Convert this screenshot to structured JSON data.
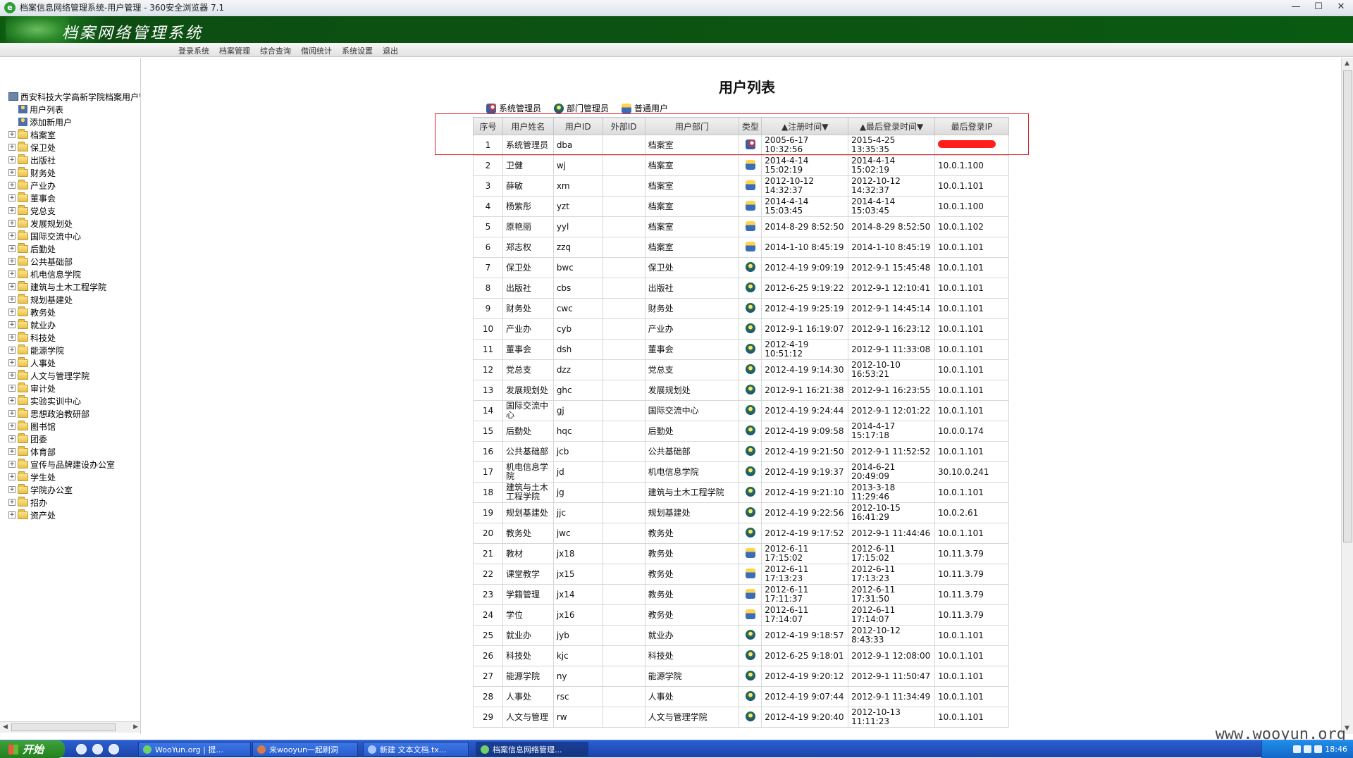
{
  "window": {
    "title": "档案信息网络管理系统-用户管理 - 360安全浏览器 7.1",
    "app_icon": "e"
  },
  "banner": {
    "system_name": "档案网络管理系统"
  },
  "menu": [
    "登录系统",
    "档案管理",
    "综合查询",
    "借阅统计",
    "系统设置",
    "退出"
  ],
  "sidebar": {
    "root": "西安科技大学高新学院档案用户管",
    "user_items": [
      "用户列表",
      "添加新用户"
    ],
    "folders": [
      "档案室",
      "保卫处",
      "出版社",
      "财务处",
      "产业办",
      "董事会",
      "党总支",
      "发展规划处",
      "国际交流中心",
      "后勤处",
      "公共基础部",
      "机电信息学院",
      "建筑与土木工程学院",
      "规划基建处",
      "教务处",
      "就业办",
      "科技处",
      "能源学院",
      "人事处",
      "人文与管理学院",
      "审计处",
      "实验实训中心",
      "思想政治教研部",
      "图书馆",
      "团委",
      "体育部",
      "宣传与品牌建设办公室",
      "学生处",
      "学院办公室",
      "招办",
      "资产处"
    ]
  },
  "page": {
    "title": "用户列表",
    "legend": [
      {
        "icon": "admin-user-icon",
        "label": "系统管理员"
      },
      {
        "icon": "dept-admin-icon",
        "label": "部门管理员"
      },
      {
        "icon": "normal-user-icon",
        "label": "普通用户"
      }
    ],
    "columns": [
      "序号",
      "用户姓名",
      "用户ID",
      "外部ID",
      "用户部门",
      "类型",
      "▲注册时间▼",
      "▲最后登录时间▼",
      "最后登录IP"
    ],
    "rows": [
      {
        "idx": "1",
        "name": "系统管理员",
        "uid": "dba",
        "ext": "",
        "dept": "档案室",
        "type": "admin",
        "reg": "2005-6-17 10:32:56",
        "last": "2015-4-25 13:35:35",
        "ip": "",
        "redacted": true
      },
      {
        "idx": "2",
        "name": "卫健",
        "uid": "wj",
        "ext": "",
        "dept": "档案室",
        "type": "normal",
        "reg": "2014-4-14 15:02:19",
        "last": "2014-4-14 15:02:19",
        "ip": "10.0.1.100"
      },
      {
        "idx": "3",
        "name": "薛敏",
        "uid": "xm",
        "ext": "",
        "dept": "档案室",
        "type": "normal",
        "reg": "2012-10-12 14:32:37",
        "last": "2012-10-12 14:32:37",
        "ip": "10.0.1.101"
      },
      {
        "idx": "4",
        "name": "杨紫彤",
        "uid": "yzt",
        "ext": "",
        "dept": "档案室",
        "type": "normal",
        "reg": "2014-4-14 15:03:45",
        "last": "2014-4-14 15:03:45",
        "ip": "10.0.1.100"
      },
      {
        "idx": "5",
        "name": "原艳丽",
        "uid": "yyl",
        "ext": "",
        "dept": "档案室",
        "type": "normal",
        "reg": "2014-8-29 8:52:50",
        "last": "2014-8-29 8:52:50",
        "ip": "10.0.1.102"
      },
      {
        "idx": "6",
        "name": "郑志权",
        "uid": "zzq",
        "ext": "",
        "dept": "档案室",
        "type": "normal",
        "reg": "2014-1-10 8:45:19",
        "last": "2014-1-10 8:45:19",
        "ip": "10.0.1.101"
      },
      {
        "idx": "7",
        "name": "保卫处",
        "uid": "bwc",
        "ext": "",
        "dept": "保卫处",
        "type": "dept",
        "reg": "2012-4-19 9:09:19",
        "last": "2012-9-1 15:45:48",
        "ip": "10.0.1.101"
      },
      {
        "idx": "8",
        "name": "出版社",
        "uid": "cbs",
        "ext": "",
        "dept": "出版社",
        "type": "dept",
        "reg": "2012-6-25 9:19:22",
        "last": "2012-9-1 12:10:41",
        "ip": "10.0.1.101"
      },
      {
        "idx": "9",
        "name": "财务处",
        "uid": "cwc",
        "ext": "",
        "dept": "财务处",
        "type": "dept",
        "reg": "2012-4-19 9:25:19",
        "last": "2012-9-1 14:45:14",
        "ip": "10.0.1.101"
      },
      {
        "idx": "10",
        "name": "产业办",
        "uid": "cyb",
        "ext": "",
        "dept": "产业办",
        "type": "dept",
        "reg": "2012-9-1 16:19:07",
        "last": "2012-9-1 16:23:12",
        "ip": "10.0.1.101"
      },
      {
        "idx": "11",
        "name": "董事会",
        "uid": "dsh",
        "ext": "",
        "dept": "董事会",
        "type": "dept",
        "reg": "2012-4-19 10:51:12",
        "last": "2012-9-1 11:33:08",
        "ip": "10.0.1.101"
      },
      {
        "idx": "12",
        "name": "党总支",
        "uid": "dzz",
        "ext": "",
        "dept": "党总支",
        "type": "dept",
        "reg": "2012-4-19 9:14:30",
        "last": "2012-10-10 16:53:21",
        "ip": "10.0.1.101"
      },
      {
        "idx": "13",
        "name": "发展规划处",
        "uid": "ghc",
        "ext": "",
        "dept": "发展规划处",
        "type": "dept",
        "reg": "2012-9-1 16:21:38",
        "last": "2012-9-1 16:23:55",
        "ip": "10.0.1.101"
      },
      {
        "idx": "14",
        "name": "国际交流中心",
        "uid": "gj",
        "ext": "",
        "dept": "国际交流中心",
        "type": "dept",
        "reg": "2012-4-19 9:24:44",
        "last": "2012-9-1 12:01:22",
        "ip": "10.0.1.101"
      },
      {
        "idx": "15",
        "name": "后勤处",
        "uid": "hqc",
        "ext": "",
        "dept": "后勤处",
        "type": "dept",
        "reg": "2012-4-19 9:09:58",
        "last": "2014-4-17 15:17:18",
        "ip": "10.0.0.174"
      },
      {
        "idx": "16",
        "name": "公共基础部",
        "uid": "jcb",
        "ext": "",
        "dept": "公共基础部",
        "type": "dept",
        "reg": "2012-4-19 9:21:50",
        "last": "2012-9-1 11:52:52",
        "ip": "10.0.1.101"
      },
      {
        "idx": "17",
        "name": "机电信息学院",
        "uid": "jd",
        "ext": "",
        "dept": "机电信息学院",
        "type": "dept",
        "reg": "2012-4-19 9:19:37",
        "last": "2014-6-21 20:49:09",
        "ip": "30.10.0.241"
      },
      {
        "idx": "18",
        "name": "建筑与土木工程学院",
        "uid": "jg",
        "ext": "",
        "dept": "建筑与土木工程学院",
        "type": "dept",
        "reg": "2012-4-19 9:21:10",
        "last": "2013-3-18 11:29:46",
        "ip": "10.0.1.101"
      },
      {
        "idx": "19",
        "name": "规划基建处",
        "uid": "jjc",
        "ext": "",
        "dept": "规划基建处",
        "type": "dept",
        "reg": "2012-4-19 9:22:56",
        "last": "2012-10-15 16:41:29",
        "ip": "10.0.2.61"
      },
      {
        "idx": "20",
        "name": "教务处",
        "uid": "jwc",
        "ext": "",
        "dept": "教务处",
        "type": "dept",
        "reg": "2012-4-19 9:17:52",
        "last": "2012-9-1 11:44:46",
        "ip": "10.0.1.101"
      },
      {
        "idx": "21",
        "name": "教材",
        "uid": "jx18",
        "ext": "",
        "dept": "教务处",
        "type": "normal",
        "reg": "2012-6-11 17:15:02",
        "last": "2012-6-11 17:15:02",
        "ip": "10.11.3.79"
      },
      {
        "idx": "22",
        "name": "课堂教学",
        "uid": "jx15",
        "ext": "",
        "dept": "教务处",
        "type": "normal",
        "reg": "2012-6-11 17:13:23",
        "last": "2012-6-11 17:13:23",
        "ip": "10.11.3.79"
      },
      {
        "idx": "23",
        "name": "学籍管理",
        "uid": "jx14",
        "ext": "",
        "dept": "教务处",
        "type": "normal",
        "reg": "2012-6-11 17:11:37",
        "last": "2012-6-11 17:31:50",
        "ip": "10.11.3.79"
      },
      {
        "idx": "24",
        "name": "学位",
        "uid": "jx16",
        "ext": "",
        "dept": "教务处",
        "type": "normal",
        "reg": "2012-6-11 17:14:07",
        "last": "2012-6-11 17:14:07",
        "ip": "10.11.3.79"
      },
      {
        "idx": "25",
        "name": "就业办",
        "uid": "jyb",
        "ext": "",
        "dept": "就业办",
        "type": "dept",
        "reg": "2012-4-19 9:18:57",
        "last": "2012-10-12 8:43:33",
        "ip": "10.0.1.101"
      },
      {
        "idx": "26",
        "name": "科技处",
        "uid": "kjc",
        "ext": "",
        "dept": "科技处",
        "type": "dept",
        "reg": "2012-6-25 9:18:01",
        "last": "2012-9-1 12:08:00",
        "ip": "10.0.1.101"
      },
      {
        "idx": "27",
        "name": "能源学院",
        "uid": "ny",
        "ext": "",
        "dept": "能源学院",
        "type": "dept",
        "reg": "2012-4-19 9:20:12",
        "last": "2012-9-1 11:50:47",
        "ip": "10.0.1.101"
      },
      {
        "idx": "28",
        "name": "人事处",
        "uid": "rsc",
        "ext": "",
        "dept": "人事处",
        "type": "dept",
        "reg": "2012-4-19 9:07:44",
        "last": "2012-9-1 11:34:49",
        "ip": "10.0.1.101"
      },
      {
        "idx": "29",
        "name": "人文与管理",
        "uid": "rw",
        "ext": "",
        "dept": "人文与管理学院",
        "type": "dept",
        "reg": "2012-4-19 9:20:40",
        "last": "2012-10-13 11:11:23",
        "ip": "10.0.1.101"
      }
    ]
  },
  "taskbar": {
    "start_label": "开始",
    "tasks": [
      "WooYun.org | 提...",
      "来wooyun一起刷洞",
      "新建 文本文档.tx...",
      "档案信息网络管理..."
    ],
    "clock": "18:46"
  },
  "watermark": "www.wooyun.org"
}
